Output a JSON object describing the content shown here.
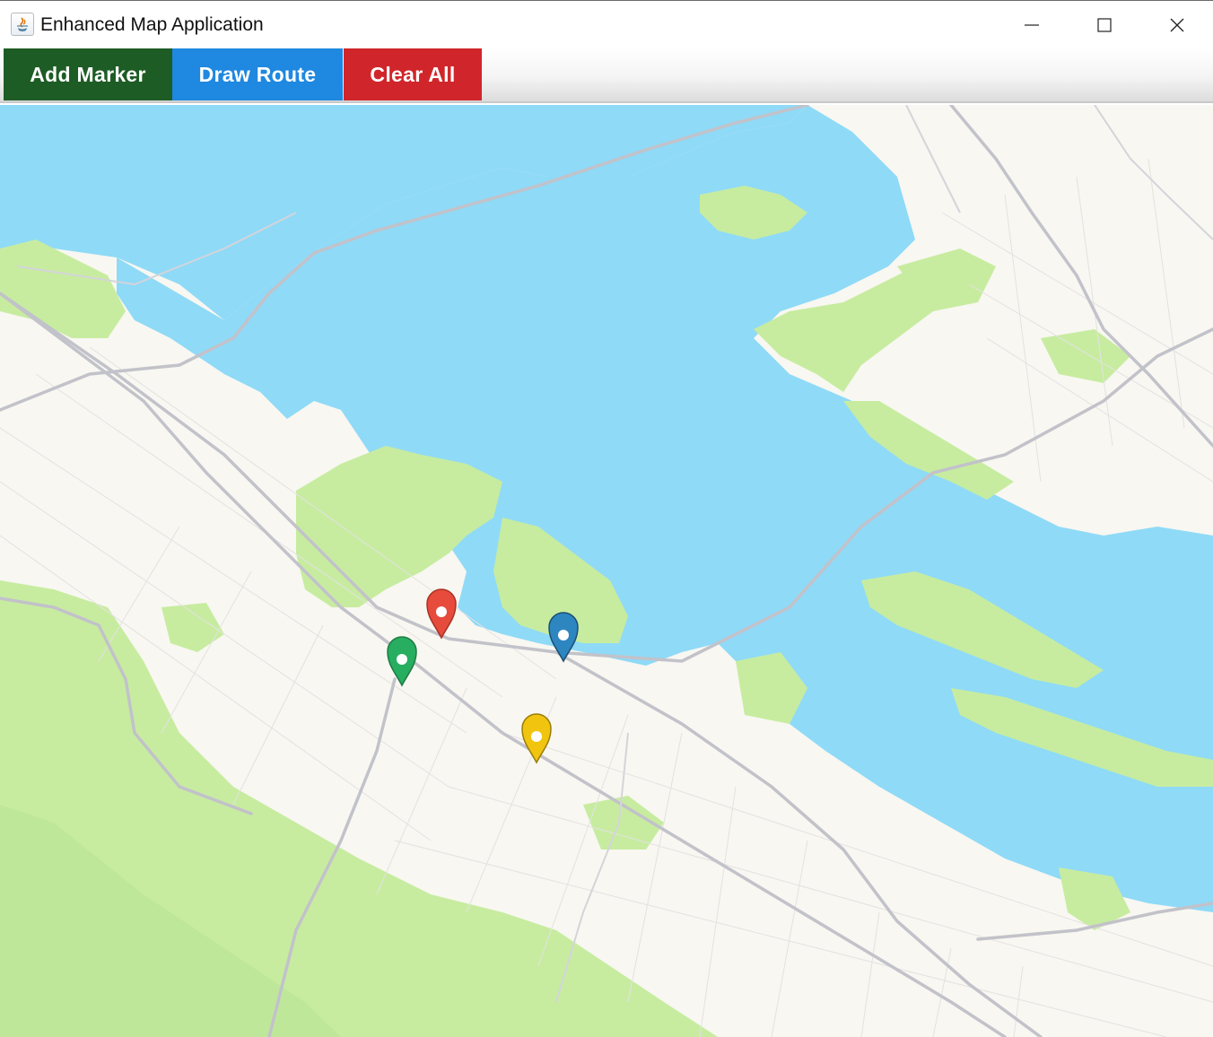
{
  "window": {
    "title": "Enhanced Map Application",
    "controls": {
      "minimize": "minimize-icon",
      "maximize": "maximize-icon",
      "close": "close-icon"
    }
  },
  "toolbar": {
    "add_marker_label": "Add Marker",
    "draw_route_label": "Draw Route",
    "clear_all_label": "Clear All",
    "colors": {
      "add_marker": "#1e5c25",
      "draw_route": "#1f88e0",
      "clear_all": "#d0262b"
    }
  },
  "map": {
    "colors": {
      "water": "#8fdaf7",
      "land": "#f8f7f1",
      "park": "#c7eca0",
      "road": "#c2c2ca",
      "minor_road": "#e3e2e2"
    },
    "markers": [
      {
        "color": "#e64b3c",
        "icon": "map-pin-red"
      },
      {
        "color": "#2e86c1",
        "icon": "map-pin-blue"
      },
      {
        "color": "#27ae60",
        "icon": "map-pin-green"
      },
      {
        "color": "#f1c40f",
        "icon": "map-pin-yellow"
      }
    ]
  }
}
